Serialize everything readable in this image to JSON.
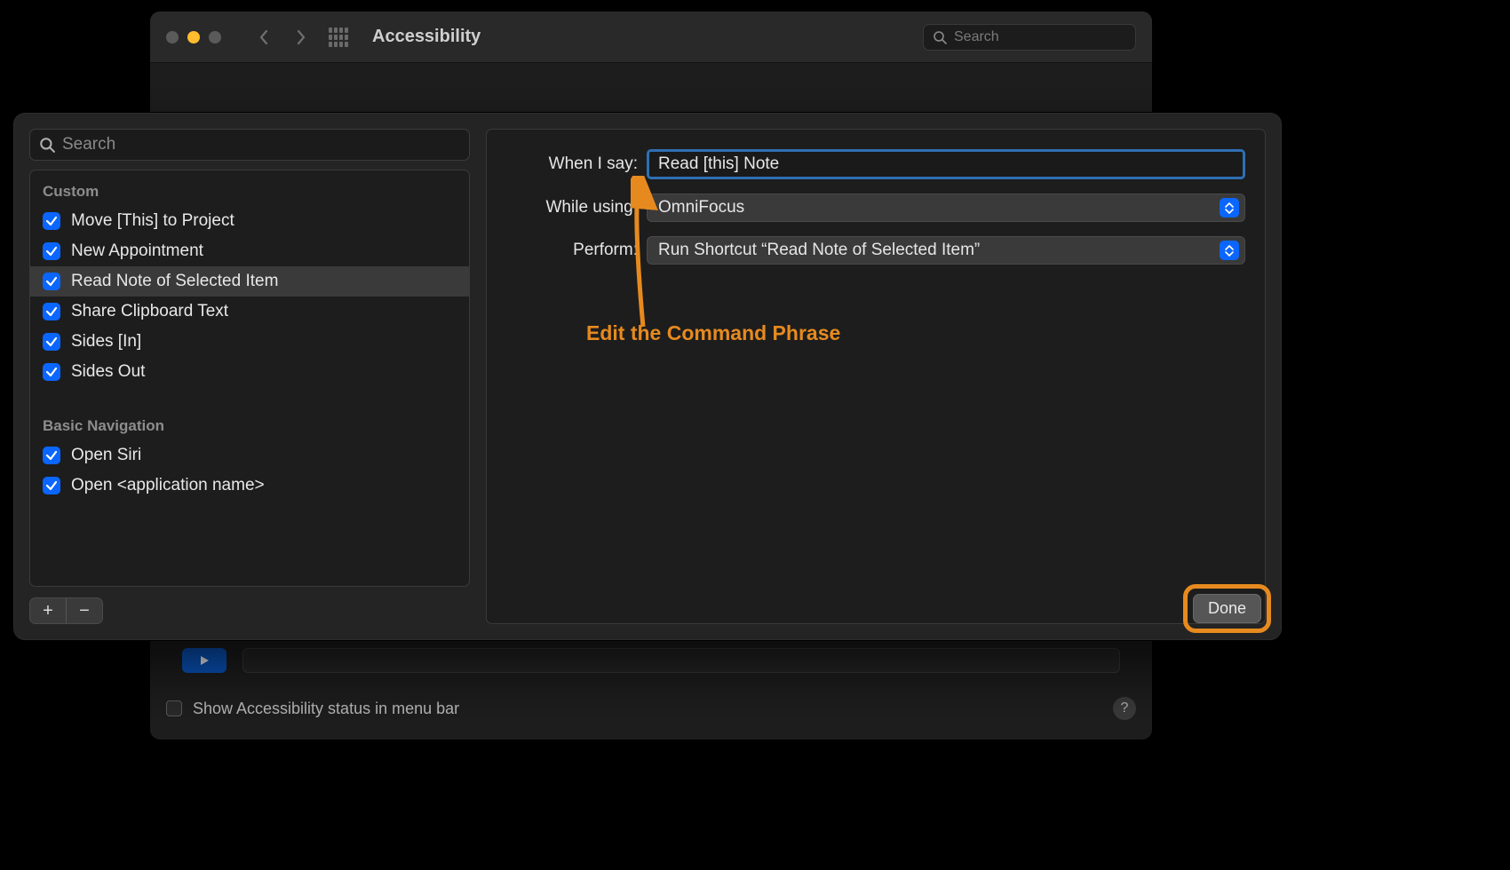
{
  "bgWindow": {
    "title": "Accessibility",
    "searchPlaceholder": "Search",
    "statusText": "Show Accessibility status in menu bar"
  },
  "sheet": {
    "searchPlaceholder": "Search",
    "sections": [
      {
        "title": "Custom",
        "items": [
          {
            "label": "Move [This] to Project",
            "checked": true,
            "selected": false
          },
          {
            "label": "New Appointment",
            "checked": true,
            "selected": false
          },
          {
            "label": "Read Note of Selected Item",
            "checked": true,
            "selected": true
          },
          {
            "label": "Share Clipboard Text",
            "checked": true,
            "selected": false
          },
          {
            "label": "Sides [In]",
            "checked": true,
            "selected": false
          },
          {
            "label": "Sides Out",
            "checked": true,
            "selected": false
          }
        ]
      },
      {
        "title": "Basic Navigation",
        "items": [
          {
            "label": "Open Siri",
            "checked": true,
            "selected": false
          },
          {
            "label": "Open <application name>",
            "checked": true,
            "selected": false
          }
        ]
      }
    ],
    "form": {
      "whenISayLabel": "When I say:",
      "whenISayValue": "Read [this] Note",
      "whileUsingLabel": "While using:",
      "whileUsingValue": "OmniFocus",
      "performLabel": "Perform:",
      "performValue": "Run Shortcut “Read Note of Selected Item”"
    },
    "addLabel": "+",
    "removeLabel": "−",
    "doneLabel": "Done"
  },
  "annotation": {
    "text": "Edit the Command Phrase"
  }
}
